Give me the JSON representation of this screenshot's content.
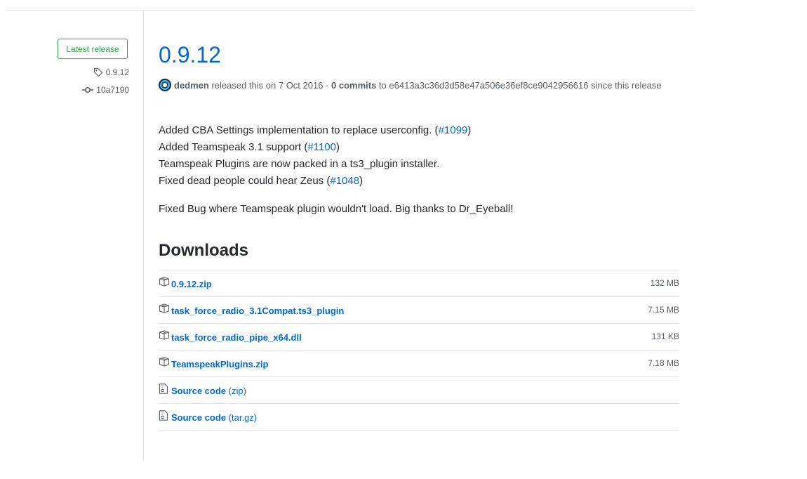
{
  "sidebar": {
    "badge": "Latest release",
    "tag": "0.9.12",
    "commit": "10a7190"
  },
  "release": {
    "title": "0.9.12",
    "author": "dedmen",
    "released_text": " released this on 7 Oct 2016 · ",
    "commits": "0 commits",
    "to_text": " to e6413a3c36d3d58e47a506e36ef8ce9042956616 since this release"
  },
  "notes": {
    "line1_text": "Added CBA Settings implementation to replace userconfig. (",
    "line1_link": "#1099",
    "line1_end": ")",
    "line2_text": "Added Teamspeak 3.1 support (",
    "line2_link": "#1100",
    "line2_end": ")",
    "line3_text": "Teamspeak Plugins are now packed in a ts3_plugin installer.",
    "line4_text": "Fixed dead people could hear Zeus (",
    "line4_link": "#1048",
    "line4_end": ")",
    "line5_text": "Fixed Bug where Teamspeak plugin wouldn't load. Big thanks to Dr_Eyeball!"
  },
  "downloads": {
    "title": "Downloads",
    "items": [
      {
        "name": "0.9.12.zip",
        "size": "132 MB",
        "icon": "package-icon"
      },
      {
        "name": "task_force_radio_3.1Compat.ts3_plugin",
        "size": "7.15 MB",
        "icon": "package-icon"
      },
      {
        "name": "task_force_radio_pipe_x64.dll",
        "size": "131 KB",
        "icon": "package-icon"
      },
      {
        "name": "TeamspeakPlugins.zip",
        "size": "7.18 MB",
        "icon": "package-icon"
      }
    ],
    "source": [
      {
        "name": "Source code",
        "suffix": "(zip)",
        "icon": "file-zip-icon"
      },
      {
        "name": "Source code",
        "suffix": "(tar.gz)",
        "icon": "file-zip-icon"
      }
    ]
  }
}
